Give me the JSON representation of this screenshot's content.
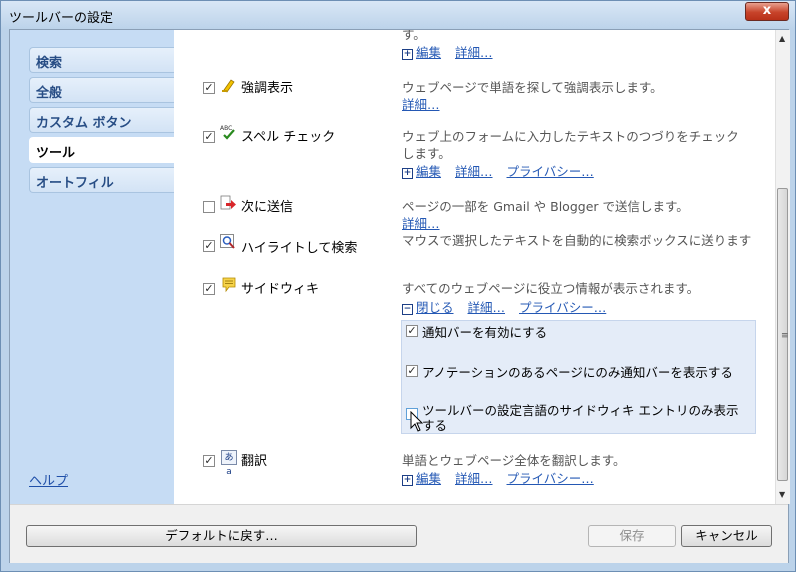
{
  "window": {
    "title": "ツールバーの設定",
    "close_glyph": "x"
  },
  "sidebar": {
    "tabs": [
      {
        "label": "検索"
      },
      {
        "label": "全般"
      },
      {
        "label": "カスタム ボタン"
      },
      {
        "label": "ツール",
        "active": true
      },
      {
        "label": "オートフィル"
      }
    ],
    "help": "ヘルプ"
  },
  "tools": {
    "top_fragment": "す。",
    "top_links": {
      "edit": "編集",
      "details": "詳細…"
    },
    "items": [
      {
        "name": "強調表示",
        "checked": true,
        "icon": "highlighter-icon",
        "desc": "ウェブページで単語を探して強調表示します。",
        "details": "詳細…"
      },
      {
        "name": "スペル チェック",
        "checked": true,
        "icon": "spellcheck-icon",
        "icon_text": "ABC",
        "desc1": "ウェブ上のフォームに入力したテキストのつづりをチェック",
        "desc2": "します。",
        "edit": "編集",
        "details": "詳細…",
        "privacy": "プライバシー…"
      },
      {
        "name": "次に送信",
        "checked": false,
        "icon": "send-to-icon",
        "desc": "ページの一部を Gmail や Blogger で送信します。",
        "details": "詳細…"
      },
      {
        "name": "ハイライトして検索",
        "checked": true,
        "icon": "highlight-search-icon",
        "desc1": "マウスで選択したテキストを自動的に検索ボックスに送ります"
      },
      {
        "name": "サイドウィキ",
        "checked": true,
        "icon": "sidewiki-icon",
        "desc": "すべてのウェブページに役立つ情報が表示されます。",
        "close": "閉じる",
        "details": "詳細…",
        "privacy": "プライバシー…",
        "options": [
          {
            "label": "通知バーを有効にする",
            "checked": true
          },
          {
            "label": "アノテーションのあるページにのみ通知バーを表示する",
            "checked": true
          },
          {
            "label1": "ツールバーの設定言語のサイドウィキ エントリのみ表示",
            "label2": "する",
            "checked": false
          }
        ]
      },
      {
        "name": "翻訳",
        "checked": true,
        "icon": "translate-icon",
        "icon_text": "あa",
        "desc": "単語とウェブページ全体を翻訳します。",
        "edit": "編集",
        "details": "詳細…",
        "privacy": "プライバシー…"
      }
    ]
  },
  "footer": {
    "default": "デフォルトに戻す…",
    "save": "保存",
    "cancel": "キャンセル"
  },
  "colors": {
    "accent": "#2458b4",
    "sidebar_bg": "#c6dcf4",
    "tab_text": "#274d85"
  }
}
